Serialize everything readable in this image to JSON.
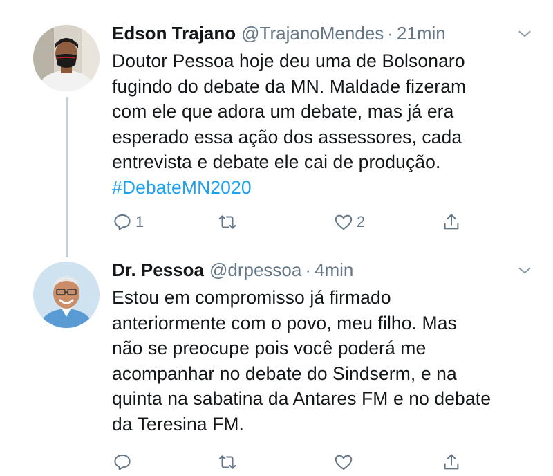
{
  "tweets": [
    {
      "display_name": "Edson Trajano",
      "handle": "@TrajanoMendes",
      "separator": "·",
      "time": "21min",
      "lines": [
        "Doutor Pessoa hoje deu uma de Bolsonaro",
        "fugindo do debate da MN. Maldade fizeram",
        "com ele que adora um debate, mas já era",
        "esperado essa ação dos assessores, cada",
        "entrevista e debate ele cai de produção."
      ],
      "hashtag": "#DebateMN2020",
      "reply_count": "1",
      "like_count": "2"
    },
    {
      "display_name": "Dr. Pessoa",
      "handle": "@drpessoa",
      "separator": "·",
      "time": "4min",
      "lines": [
        "Estou em compromisso já firmado",
        "anteriormente com o povo, meu filho. Mas",
        "não se preocupe pois você poderá me",
        "acompanhar no debate do Sindserm, e na",
        "quinta na sabatina da Antares FM e no debate",
        "da Teresina FM."
      ]
    }
  ],
  "colors": {
    "text": "#14171a",
    "secondary": "#657786",
    "link": "#1da1f2",
    "thread_line": "#c4cfd6"
  },
  "icons": [
    "reply-icon",
    "retweet-icon",
    "like-icon",
    "share-icon",
    "chevron-down-icon"
  ]
}
